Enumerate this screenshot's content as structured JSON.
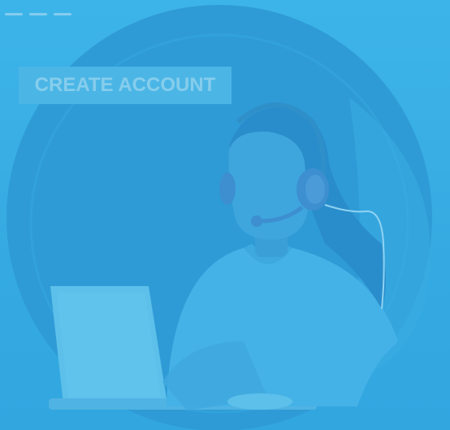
{
  "colors": {
    "background": "#38b0e6",
    "circle": "#2f9bd6",
    "button_bg": "#4bb6e6",
    "button_text": "#86cdec"
  },
  "header": {
    "menu_icon": "menu-dashes-icon"
  },
  "cta": {
    "label": "CREATE ACCOUNT"
  },
  "illustration": {
    "icon": "customer-support-agent-illustration"
  }
}
